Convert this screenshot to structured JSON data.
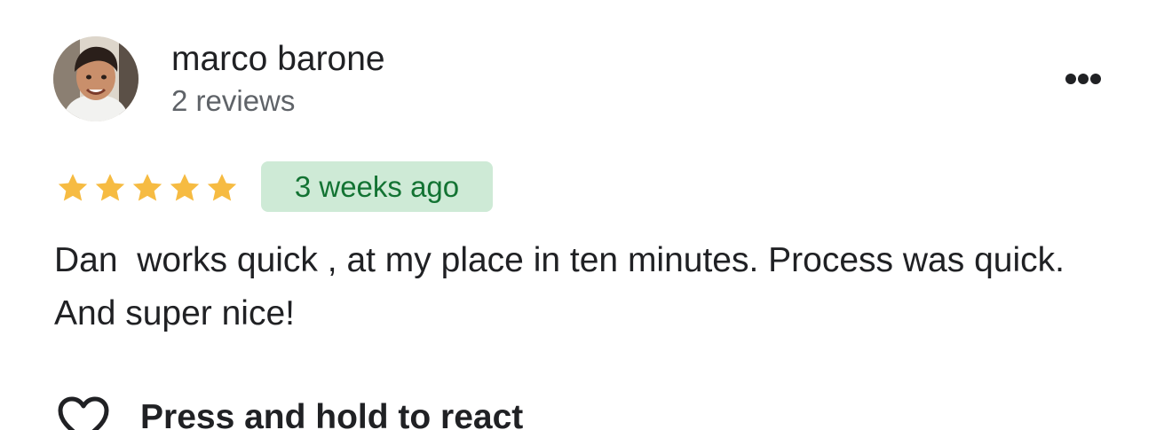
{
  "reviewer": {
    "name": "marco barone",
    "review_count": "2 reviews",
    "avatar": "reviewer-avatar-photo"
  },
  "review": {
    "rating": 5,
    "max_rating": 5,
    "age": "3 weeks ago",
    "text": "Dan  works quick , at my place in ten minutes. Process was quick. And super nice!"
  },
  "actions": {
    "more_icon": "more-horizontal-icon",
    "react_icon": "heart-outline-icon",
    "react_label": "Press and hold to react"
  },
  "colors": {
    "star": "#f6bb42",
    "badge_bg": "#ceead6",
    "badge_text": "#137333",
    "secondary_text": "#5f6368",
    "primary_text": "#202124"
  }
}
